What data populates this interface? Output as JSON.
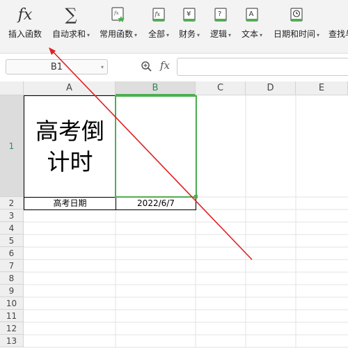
{
  "ribbon": {
    "items": [
      {
        "label": "插入函数",
        "caret": "",
        "icon": "fx-icon"
      },
      {
        "label": "自动求和",
        "caret": "▾",
        "icon": "sigma-icon"
      },
      {
        "label": "常用函数",
        "caret": "▾",
        "icon": "common-function-icon"
      },
      {
        "label": "全部",
        "caret": "▾",
        "icon": "all-functions-icon"
      },
      {
        "label": "财务",
        "caret": "▾",
        "icon": "finance-icon"
      },
      {
        "label": "逻辑",
        "caret": "▾",
        "icon": "logic-icon"
      },
      {
        "label": "文本",
        "caret": "▾",
        "icon": "text-icon"
      },
      {
        "label": "日期和时间",
        "caret": "▾",
        "icon": "datetime-icon"
      },
      {
        "label": "查找与",
        "caret": "",
        "icon": "lookup-icon"
      }
    ],
    "fx_glyph": "fx",
    "sigma_glyph": "∑",
    "yen_glyph": "¥",
    "question_glyph": "?",
    "text_glyph": "A"
  },
  "formula_bar": {
    "name_box": "B1",
    "fx_glyph": "fx",
    "formula": ""
  },
  "sheet": {
    "columns": [
      "A",
      "B",
      "C",
      "D",
      "E"
    ],
    "rows": [
      "1",
      "2",
      "3",
      "4",
      "5",
      "6",
      "7",
      "8",
      "9",
      "10",
      "11",
      "12",
      "13"
    ],
    "selected_cell": "B1",
    "cells": {
      "A1": "高考倒计时",
      "A2": "高考日期",
      "B2": "2022/6/7"
    }
  },
  "annotation": {
    "arrow_color": "#e02020"
  },
  "accent_color": "#4caf50"
}
